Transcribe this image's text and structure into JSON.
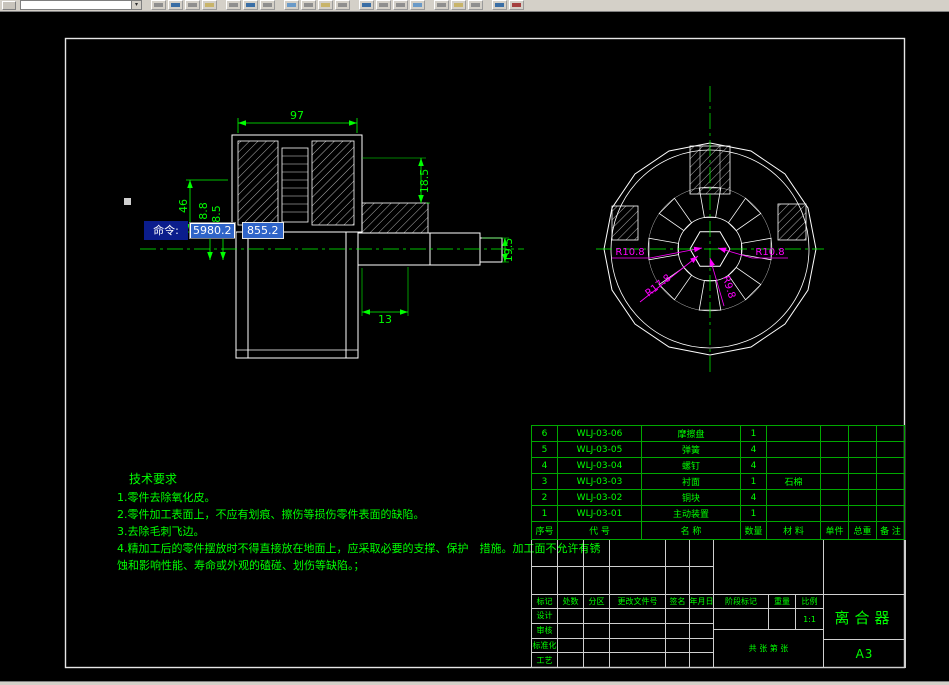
{
  "toolbar": {
    "combo_value": "",
    "dropdown_arrow": "▾"
  },
  "command": {
    "label": "命令:",
    "x_value": "5980.2",
    "y_value": "855.2"
  },
  "dims": {
    "width_top": "97",
    "height_left": "46",
    "h1": "8.8",
    "h2": "8.5",
    "step": "18.5",
    "shaft_end": "19.5",
    "step_len": "13"
  },
  "radial_dims": {
    "left": "R10.8",
    "mid": "R17.8",
    "right": "R10.8",
    "inner": "R9.8"
  },
  "tech_requirements": {
    "title": "技术要求",
    "lines": [
      "1.零件去除氧化皮。",
      "2.零件加工表面上，不应有划痕、擦伤等损伤零件表面的缺陷。",
      "3.去除毛刺飞边。",
      "4.精加工后的零件摆放时不得直接放在地面上，应采取必要的支撑、保护　措施。加工面不允许有锈",
      "蚀和影响性能、寿命或外观的磕碰、划伤等缺陷。；"
    ]
  },
  "bom": {
    "rows": [
      {
        "seq": "6",
        "code": "WLJ-03-06",
        "name": "摩擦盘",
        "qty": "1",
        "material": ""
      },
      {
        "seq": "5",
        "code": "WLJ-03-05",
        "name": "弹簧",
        "qty": "4",
        "material": ""
      },
      {
        "seq": "4",
        "code": "WLJ-03-04",
        "name": "螺钉",
        "qty": "4",
        "material": ""
      },
      {
        "seq": "3",
        "code": "WLJ-03-03",
        "name": "衬面",
        "qty": "1",
        "material": "石棉"
      },
      {
        "seq": "2",
        "code": "WLJ-03-02",
        "name": "铜块",
        "qty": "4",
        "material": ""
      },
      {
        "seq": "1",
        "code": "WLJ-03-01",
        "name": "主动装置",
        "qty": "1",
        "material": ""
      }
    ],
    "headers": {
      "seq": "序号",
      "code": "代  号",
      "name": "名  称",
      "qty": "数量",
      "material": "材  料",
      "unit_weight": "单件",
      "total_weight": "总重",
      "note": "备 注"
    }
  },
  "titleblock": {
    "rev_headers": {
      "mark": "标记",
      "count": "处数",
      "zone": "分区",
      "doc_no": "更改文件号",
      "sign": "签名",
      "date": "年月日"
    },
    "roles": {
      "design": "设计",
      "check": "审核",
      "std": "标准化",
      "craft": "工艺"
    },
    "stage_label": "阶段标记",
    "weight_label": "重量",
    "scale_label": "比例",
    "scale_value": "1:1",
    "sheets": "共 张 第 张",
    "title": "离合器",
    "sheet_size": "A3"
  }
}
